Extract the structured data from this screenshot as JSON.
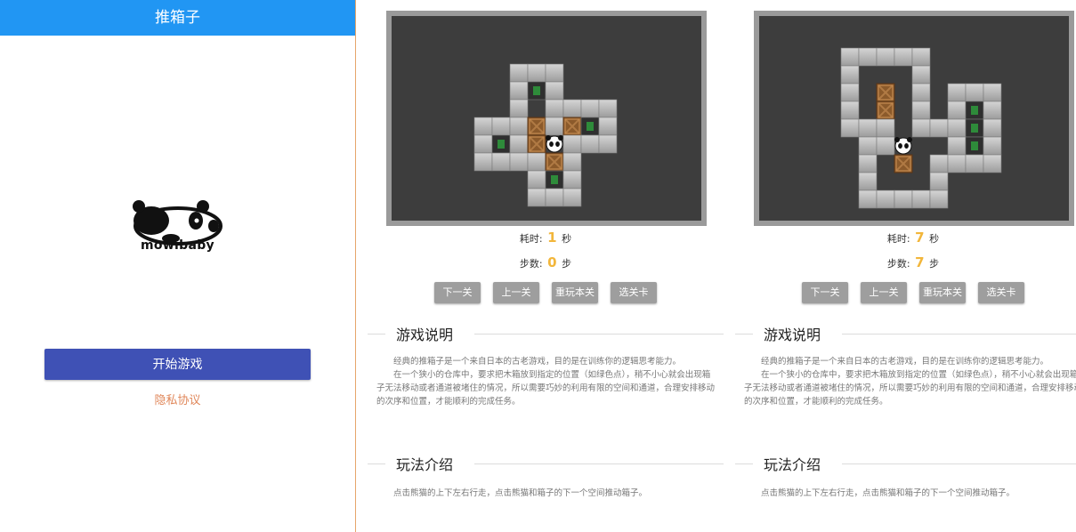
{
  "home": {
    "title": "推箱子",
    "logo_text": "mowibaby",
    "start_label": "开始游戏",
    "privacy_label": "隐私协议"
  },
  "games": [
    {
      "time_label": "耗时:",
      "time_value": "1",
      "time_unit": "秒",
      "steps_label": "步数:",
      "steps_value": "0",
      "steps_unit": "步"
    },
    {
      "time_label": "耗时:",
      "time_value": "7",
      "time_unit": "秒",
      "steps_label": "步数:",
      "steps_value": "7",
      "steps_unit": "步"
    }
  ],
  "buttons": {
    "next": "下一关",
    "prev": "上一关",
    "replay": "重玩本关",
    "select": "选关卡"
  },
  "help": {
    "title": "游戏说明",
    "para1": "经典的推箱子是一个来自日本的古老游戏，目的是在训练你的逻辑思考能力。",
    "para2": "在一个狭小的仓库中，要求把木箱放到指定的位置（如绿色点），稍不小心就会出现箱子无法移动或者通道被堵住的情况，所以需要巧妙的利用有限的空间和通道，合理安排移动的次序和位置，才能顺利的完成任务。"
  },
  "rules": {
    "title": "玩法介绍",
    "para1": "点击熊猫的上下左右行走，点击熊猫和箱子的下一个空间推动箱子。"
  },
  "colors": {
    "appbar": "#2196f3",
    "start_button": "#3f51b5",
    "privacy": "#e0875a",
    "counter": "#f2b63b",
    "board_bg": "#3d3d3d"
  }
}
